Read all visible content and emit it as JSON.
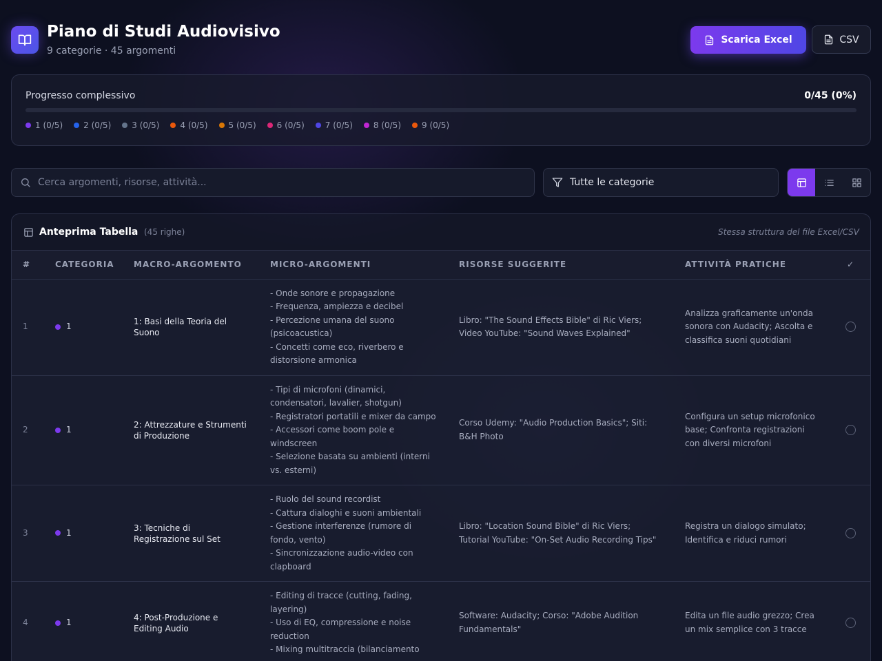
{
  "header": {
    "title": "Piano di Studi Audiovisivo",
    "subtitle": "9 categorie · 45 argomenti",
    "excel_label": "Scarica Excel",
    "csv_label": "CSV"
  },
  "progress": {
    "label": "Progresso complessivo",
    "value_text": "0/45 (0%)",
    "fraction": 0,
    "categories": [
      {
        "label": "1 (0/5)",
        "color": "#7c3aed"
      },
      {
        "label": "2 (0/5)",
        "color": "#2563eb"
      },
      {
        "label": "3 (0/5)",
        "color": "#64748b"
      },
      {
        "label": "4 (0/5)",
        "color": "#ea580c"
      },
      {
        "label": "5 (0/5)",
        "color": "#d97706"
      },
      {
        "label": "6 (0/5)",
        "color": "#db2777"
      },
      {
        "label": "7 (0/5)",
        "color": "#4f46e5"
      },
      {
        "label": "8 (0/5)",
        "color": "#c026d3"
      },
      {
        "label": "9 (0/5)",
        "color": "#ea580c"
      }
    ]
  },
  "toolbar": {
    "search_placeholder": "Cerca argomenti, risorse, attività...",
    "filter_label": "Tutte le categorie",
    "views": [
      "table-view-icon",
      "list-view-icon",
      "grid-view-icon"
    ],
    "active_view": 0
  },
  "table": {
    "title": "Anteprima Tabella",
    "count": "(45 righe)",
    "note": "Stessa struttura del file Excel/CSV",
    "columns": [
      "#",
      "Categoria",
      "Macro-Argomento",
      "Micro-Argomenti",
      "Risorse Suggerite",
      "Attività Pratiche",
      "✓"
    ],
    "rows": [
      {
        "num": "1",
        "category": "1",
        "color": "#7c3aed",
        "macro": "1: Basi della Teoria del Suono",
        "micro": [
          "- Onde sonore e propagazione",
          "- Frequenza, ampiezza e decibel",
          "- Percezione umana del suono (psicoacustica)",
          "- Concetti come eco, riverbero e distorsione armonica"
        ],
        "resources": "Libro: \"The Sound Effects Bible\" di Ric Viers; Video YouTube: \"Sound Waves Explained\"",
        "activities": "Analizza graficamente un'onda sonora con Audacity; Ascolta e classifica suoni quotidiani"
      },
      {
        "num": "2",
        "category": "1",
        "color": "#7c3aed",
        "macro": "2: Attrezzature e Strumenti di Produzione",
        "micro": [
          "- Tipi di microfoni (dinamici, condensatori, lavalier, shotgun)",
          "- Registratori portatili e mixer da campo",
          "- Accessori come boom pole e windscreen",
          "- Selezione basata su ambienti (interni vs. esterni)"
        ],
        "resources": "Corso Udemy: \"Audio Production Basics\"; Siti: B&H Photo",
        "activities": "Configura un setup microfonico base; Confronta registrazioni con diversi microfoni"
      },
      {
        "num": "3",
        "category": "1",
        "color": "#7c3aed",
        "macro": "3: Tecniche di Registrazione sul Set",
        "micro": [
          "- Ruolo del sound recordist",
          "- Cattura dialoghi e suoni ambientali",
          "- Gestione interferenze (rumore di fondo, vento)",
          "- Sincronizzazione audio-video con clapboard"
        ],
        "resources": "Libro: \"Location Sound Bible\" di Ric Viers; Tutorial YouTube: \"On-Set Audio Recording Tips\"",
        "activities": "Registra un dialogo simulato; Identifica e riduci rumori"
      },
      {
        "num": "4",
        "category": "1",
        "color": "#7c3aed",
        "macro": "4: Post-Produzione e Editing Audio",
        "micro": [
          "- Editing di tracce (cutting, fading, layering)",
          "- Uso di EQ, compressione e noise reduction",
          "- Mixing multitraccia (bilanciamento"
        ],
        "resources": "Software: Audacity; Corso: \"Adobe Audition Fundamentals\"",
        "activities": "Edita un file audio grezzo; Crea un mix semplice con 3 tracce"
      }
    ]
  }
}
